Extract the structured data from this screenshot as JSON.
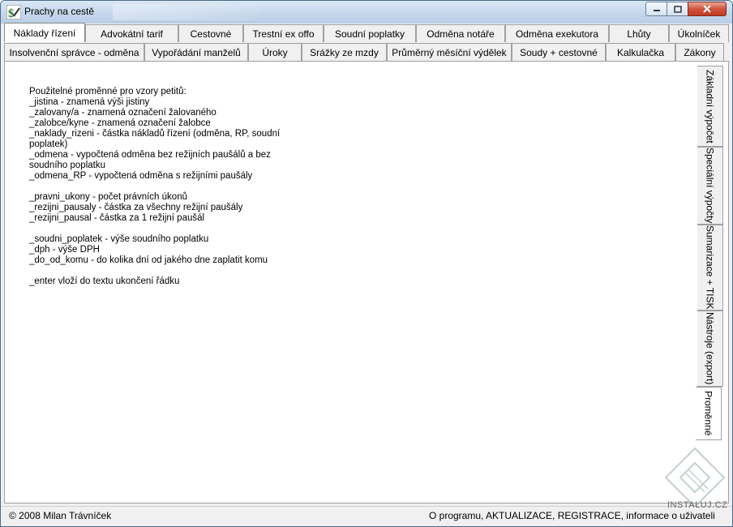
{
  "window": {
    "title": "Prachy na cestě"
  },
  "tabs_row1": [
    {
      "label": "Náklady řízení",
      "active": true
    },
    {
      "label": "Advokátní tarif"
    },
    {
      "label": "Cestovné"
    },
    {
      "label": "Trestní ex offo"
    },
    {
      "label": "Soudní poplatky"
    },
    {
      "label": "Odměna notáře"
    },
    {
      "label": "Odměna exekutora"
    },
    {
      "label": "Lhůty"
    },
    {
      "label": "Úkolníček"
    }
  ],
  "tabs_row2": [
    {
      "label": "Insolvenční správce - odměna"
    },
    {
      "label": "Vypořádání manželů"
    },
    {
      "label": "Úroky"
    },
    {
      "label": "Srážky ze mzdy"
    },
    {
      "label": "Průměrný měsíční výdělek"
    },
    {
      "label": "Soudy + cestovné"
    },
    {
      "label": "Kalkulačka"
    },
    {
      "label": "Zákony"
    }
  ],
  "side_tabs": [
    {
      "label": "Základní výpočet"
    },
    {
      "label": "Speciální výpočty"
    },
    {
      "label": "Sumarizace + TISK"
    },
    {
      "label": "Nástroje (export)"
    },
    {
      "label": "Proměnné",
      "active": true
    }
  ],
  "help_lines": [
    "Použitelné proměnné pro vzory petitů:",
    "_jistina - znamená výši jistiny",
    "_zalovany/a - znamená označení žalovaného",
    "_zalobce/kyne - znamená označení žalobce",
    "_naklady_rizeni - částka nákladů řízení (odměna, RP, soudní",
    "poplatek)",
    "_odmena - vypočtená odměna bez režijních paušálů a bez",
    "soudního poplatku",
    "_odmena_RP - vypočtená odměna s režijními paušály",
    "",
    "_pravni_ukony - počet právních úkonů",
    "_rezijni_pausaly - částka za všechny režijní paušály",
    "_rezijni_pausal - částka za 1 režijní paušál",
    "",
    "_soudni_poplatek - výše soudního poplatku",
    "_dph - výše DPH",
    "_do_od_komu - do kolika dní od jakého dne zaplatit komu",
    "",
    "_enter vloží do textu ukončení řádku"
  ],
  "status": {
    "copyright": "© 2008 Milan Trávníček",
    "links": "O programu, AKTUALIZACE, REGISTRACE, informace o uživateli"
  },
  "watermark": {
    "text": "INSTALUJ.CZ"
  },
  "colors": {
    "close_button": "#c94a33",
    "titlebar": "#c5d7ec",
    "panel": "#ffffff"
  }
}
